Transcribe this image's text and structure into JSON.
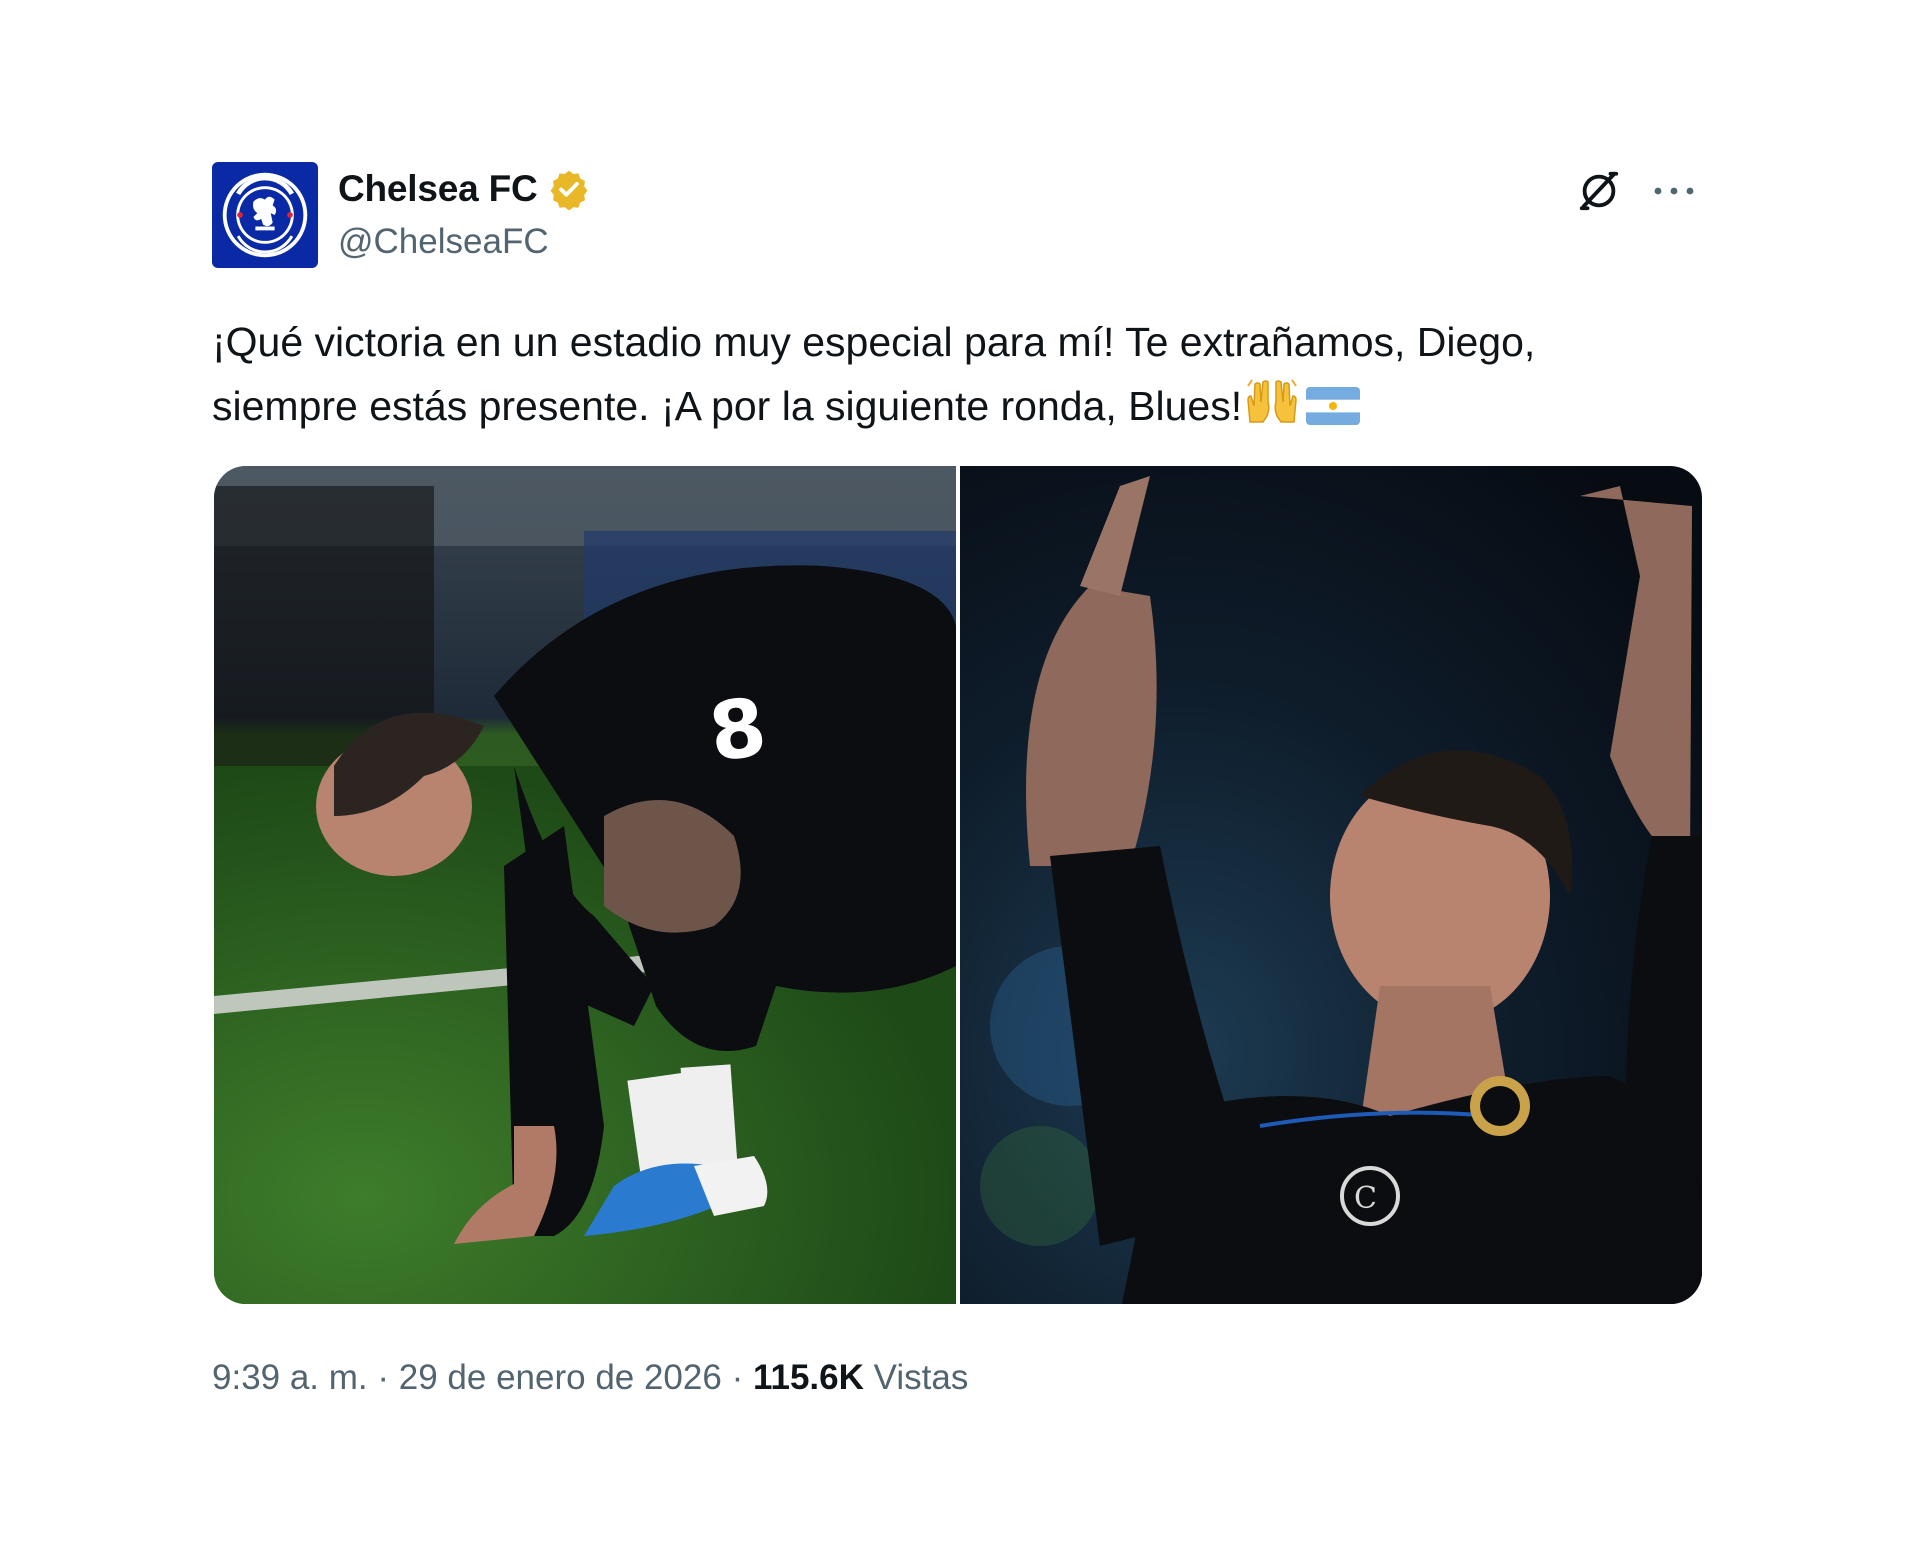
{
  "account": {
    "name": "Chelsea FC",
    "handle": "@ChelseaFC",
    "avatar_icon": "chelsea-crest",
    "verified_icon": "verified-gold-badge"
  },
  "actions": {
    "grok_icon": "grok-icon",
    "more_icon": "more-horizontal-icon"
  },
  "text": {
    "line1": "¡Qué victoria en un estadio muy especial para mí! Te extrañamos, Diego,",
    "line2": "siempre estás presente. ¡A por la siguiente ronda, Blues!",
    "emojis": [
      "raising-hands",
      "argentina-flag"
    ]
  },
  "media": [
    {
      "description_icon": "photo-player-kneeling",
      "shirt_number": "8"
    },
    {
      "description_icon": "photo-player-pointing-up"
    }
  ],
  "meta": {
    "time": "9:39 a. m.",
    "separator": "·",
    "date": "29 de enero de 2026",
    "views_count": "115.6K",
    "views_label": "Vistas"
  },
  "colors": {
    "text": "#0f1419",
    "muted": "#536471",
    "verified": "#e8b829",
    "chelsea_blue": "#0a2aa5"
  }
}
